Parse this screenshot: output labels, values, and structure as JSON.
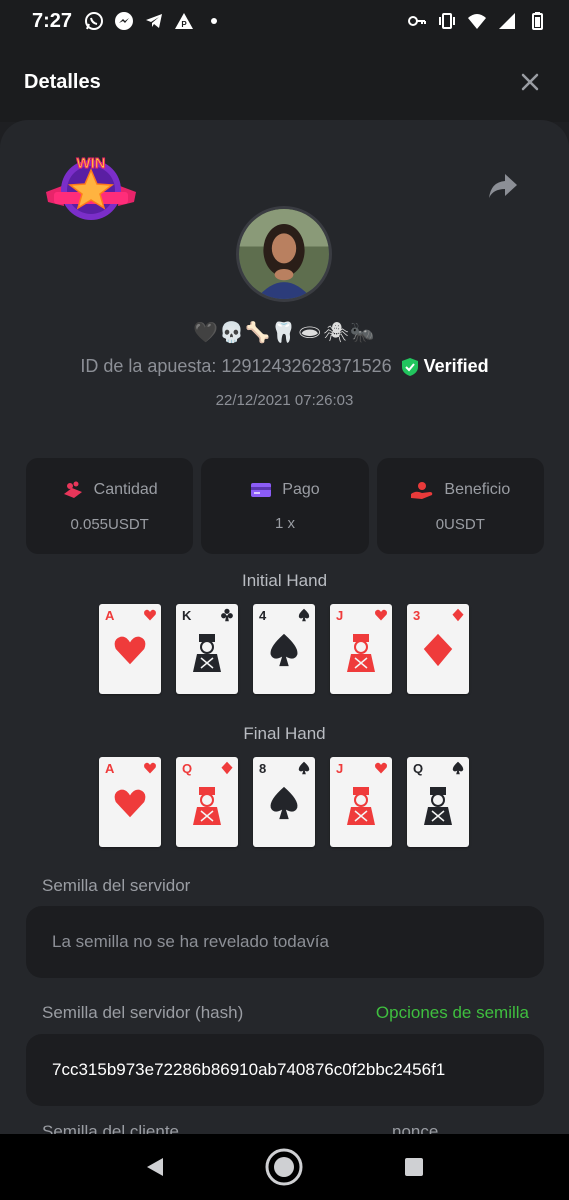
{
  "status_bar": {
    "time": "7:27",
    "left_icons": [
      "whatsapp-icon",
      "messenger-icon",
      "telegram-icon",
      "app-icon",
      "dot-icon"
    ],
    "right_icons": [
      "key-icon",
      "vibrate-icon",
      "wifi-icon",
      "signal-icon",
      "battery-icon"
    ]
  },
  "header": {
    "title": "Detalles"
  },
  "win_badge": {
    "text": "WIN"
  },
  "username": "🖤💀🦴🦷🕳🕷🐜",
  "bet": {
    "id_label": "ID de la apuesta: 12912432628371526",
    "verified_label": "Verified",
    "date": "22/12/2021 07:26:03"
  },
  "stats": [
    {
      "label": "Cantidad",
      "value": "0.055USDT",
      "icon": "coins-icon",
      "color": "#e8365a"
    },
    {
      "label": "Pago",
      "value": "1 x",
      "icon": "card-icon",
      "color": "#8b5cf6"
    },
    {
      "label": "Beneficio",
      "value": "0USDT",
      "icon": "profit-hand-icon",
      "color": "#e83a3a"
    }
  ],
  "initial_hand": {
    "title": "Initial Hand",
    "cards": [
      {
        "rank": "A",
        "suit": "hearts",
        "color": "red"
      },
      {
        "rank": "K",
        "suit": "clubs",
        "color": "black"
      },
      {
        "rank": "4",
        "suit": "spades",
        "color": "black"
      },
      {
        "rank": "J",
        "suit": "hearts",
        "color": "red"
      },
      {
        "rank": "3",
        "suit": "diamonds",
        "color": "red"
      }
    ]
  },
  "final_hand": {
    "title": "Final Hand",
    "cards": [
      {
        "rank": "A",
        "suit": "hearts",
        "color": "red"
      },
      {
        "rank": "Q",
        "suit": "diamonds",
        "color": "red"
      },
      {
        "rank": "8",
        "suit": "spades",
        "color": "black"
      },
      {
        "rank": "J",
        "suit": "hearts",
        "color": "red"
      },
      {
        "rank": "Q",
        "suit": "spades",
        "color": "black"
      }
    ]
  },
  "server_seed": {
    "label": "Semilla del servidor",
    "value": "La semilla no se ha revelado todavía"
  },
  "server_seed_hash": {
    "label": "Semilla del servidor (hash)",
    "link": "Opciones de semilla",
    "value": "7cc315b973e72286b86910ab740876c0f2bbc2456f1"
  },
  "client_seed": {
    "label": "Semilla del cliente",
    "nonce_label": "nonce"
  },
  "nav": {
    "back": "back-icon",
    "home": "home-icon",
    "recents": "recents-icon"
  }
}
